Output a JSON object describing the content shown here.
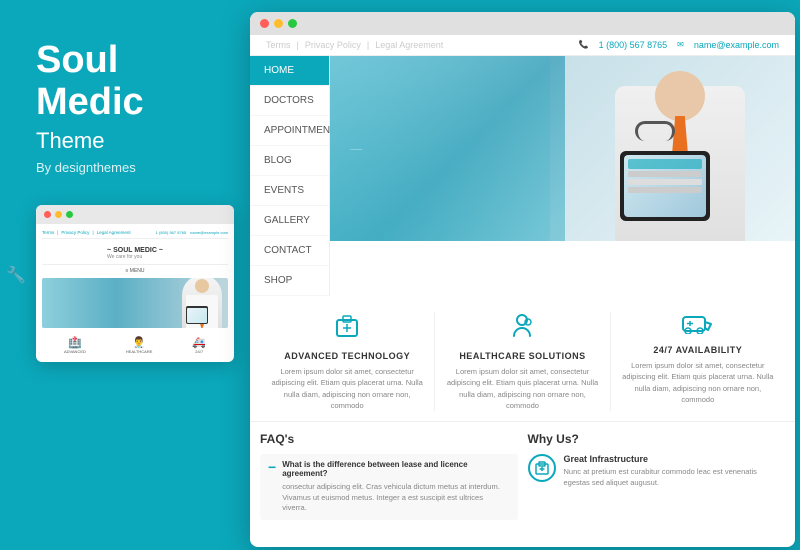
{
  "left": {
    "title_line1": "Soul",
    "title_line2": "Medic",
    "subtitle": "Theme",
    "by": "By designthemes"
  },
  "mini_browser": {
    "topbar": {
      "links": [
        "Terms",
        "Privacy Policy",
        "Legal Agreement"
      ],
      "contact_phone": "1 (800) 567 8765",
      "contact_email": "name@example.com"
    },
    "logo": "~ SOUL MEDIC ~",
    "logo_sub": "We care for you",
    "menu": "≡  MENU"
  },
  "main_browser": {
    "topbar": {
      "links": [
        "Terms",
        "Privacy Policy",
        "Legal Agreement"
      ],
      "contact_phone": "1 (800) 567 8765",
      "contact_email": "name@example.com"
    },
    "nav": {
      "items": [
        "HOME",
        "DOCTORS",
        "APPOINTMENTS",
        "BLOG",
        "EVENTS",
        "GALLERY",
        "CONTACT",
        "SHOP"
      ]
    },
    "features": [
      {
        "icon": "🏥",
        "title": "ADVANCED TECHNOLOGY",
        "text": "Lorem ipsum dolor sit amet, consectetur adipiscing elit. Etiam quis placerat urna. Nulla nulla diam, adipiscing non ornare non, commodo"
      },
      {
        "icon": "👨‍⚕️",
        "title": "HEALTHCARE SOLUTIONS",
        "text": "Lorem ipsum dolor sit amet, consectetur adipiscing elit. Etiam quis placerat urna. Nulla nulla diam, adipiscing non ornare non, commodo"
      },
      {
        "icon": "🚑",
        "title": "24/7 AVAILABILITY",
        "text": "Lorem ipsum dolor sit amet, consectetur adipiscing elit. Etiam quis placerat urna. Nulla nulla diam, adipiscing non ornare non, commodo"
      }
    ],
    "faqs": {
      "title": "FAQ's",
      "question": "What is the difference between lease and licence agreement?",
      "answer": "consectur adipiscing elit. Cras vehicula dictum metus at interdum. Vivamus ut euismod metus. Integer a est suscipit est ultrices viverra."
    },
    "why": {
      "title": "Why Us?",
      "item_title": "Great Infrastructure",
      "item_text": "Nunc at pretium est curabitur commodo leac est venenatis egestas sed aliquet augusut."
    }
  }
}
